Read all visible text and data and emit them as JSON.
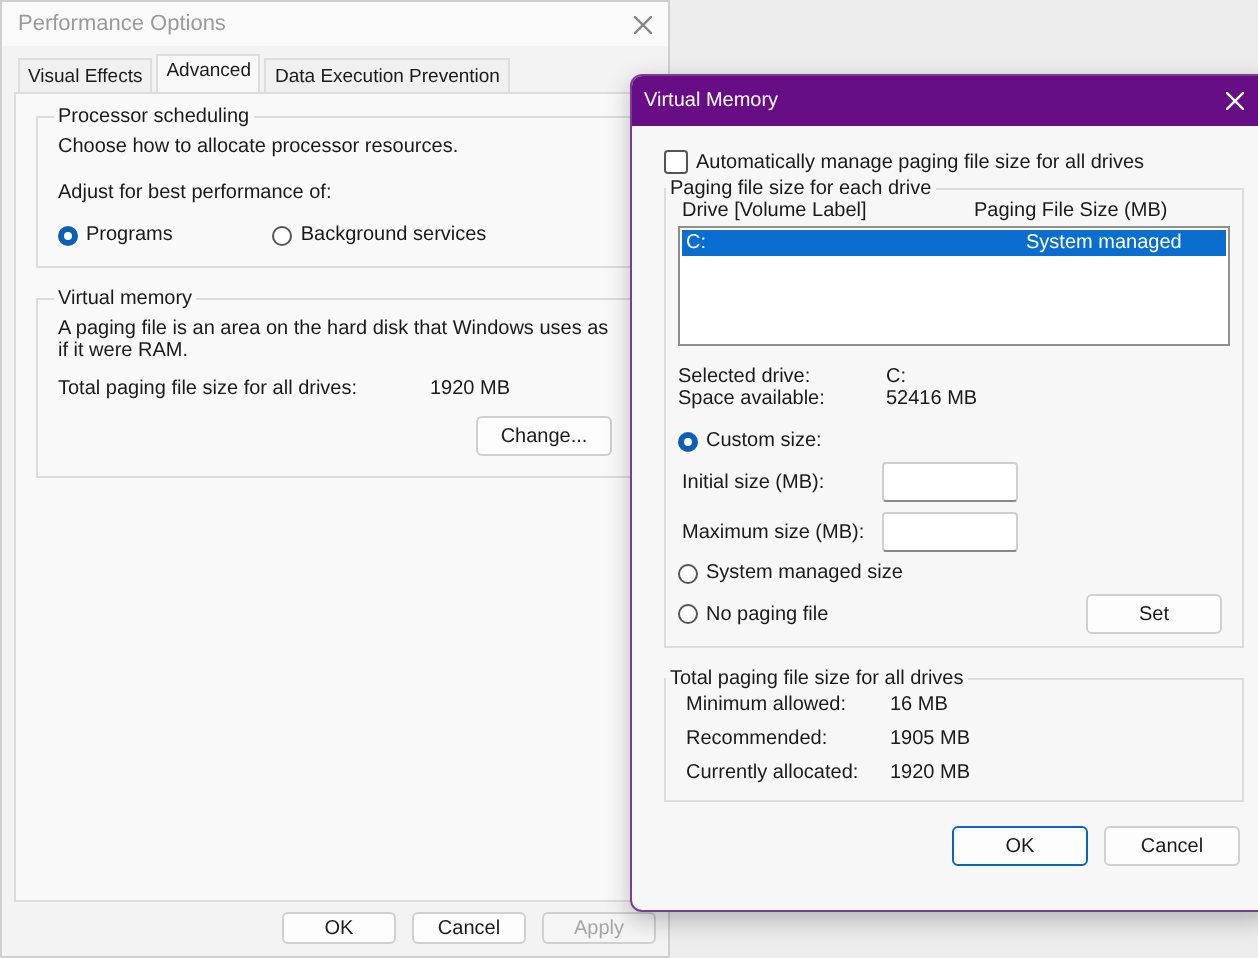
{
  "performance_options": {
    "title": "Performance Options",
    "tabs": [
      {
        "label": "Visual Effects",
        "selected": false
      },
      {
        "label": "Advanced",
        "selected": true
      },
      {
        "label": "Data Execution Prevention",
        "selected": false
      }
    ],
    "processor_scheduling": {
      "title": "Processor scheduling",
      "description": "Choose how to allocate processor resources.",
      "adjust_label": "Adjust for best performance of:",
      "options": [
        {
          "label": "Programs",
          "selected": true
        },
        {
          "label": "Background services",
          "selected": false
        }
      ]
    },
    "virtual_memory": {
      "title": "Virtual memory",
      "description": "A paging file is an area on the hard disk that Windows uses as if it were RAM.",
      "total_label": "Total paging file size for all drives:",
      "total_value": "1920 MB",
      "change_button": "Change..."
    },
    "buttons": [
      {
        "label": "OK",
        "disabled": false
      },
      {
        "label": "Cancel",
        "disabled": false
      },
      {
        "label": "Apply",
        "disabled": true
      }
    ]
  },
  "virtual_memory_dialog": {
    "title": "Virtual Memory",
    "auto_manage": {
      "label": "Automatically manage paging file size for all drives",
      "checked": false
    },
    "paging_group": {
      "title": "Paging file size for each drive",
      "columns": [
        "Drive  [Volume Label]",
        "Paging File Size (MB)"
      ],
      "drives": [
        {
          "drive": "C:",
          "size": "System managed",
          "selected": true
        }
      ],
      "info": [
        {
          "label": "Selected drive:",
          "value": "C:"
        },
        {
          "label": "Space available:",
          "value": "52416 MB"
        }
      ],
      "size_options": [
        {
          "label": "Custom size:",
          "selected": true
        },
        {
          "label": "System managed size",
          "selected": false
        },
        {
          "label": "No paging file",
          "selected": false
        }
      ],
      "fields": [
        {
          "label": "Initial size (MB):"
        },
        {
          "label": "Maximum size (MB):"
        }
      ],
      "set_button": "Set"
    },
    "totals_group": {
      "title": "Total paging file size for all drives",
      "rows": [
        {
          "label": "Minimum allowed:",
          "value": "16 MB"
        },
        {
          "label": "Recommended:",
          "value": "1905 MB"
        },
        {
          "label": "Currently allocated:",
          "value": "1920 MB"
        }
      ]
    },
    "buttons": [
      {
        "label": "OK",
        "default": true
      },
      {
        "label": "Cancel",
        "default": false
      }
    ]
  }
}
